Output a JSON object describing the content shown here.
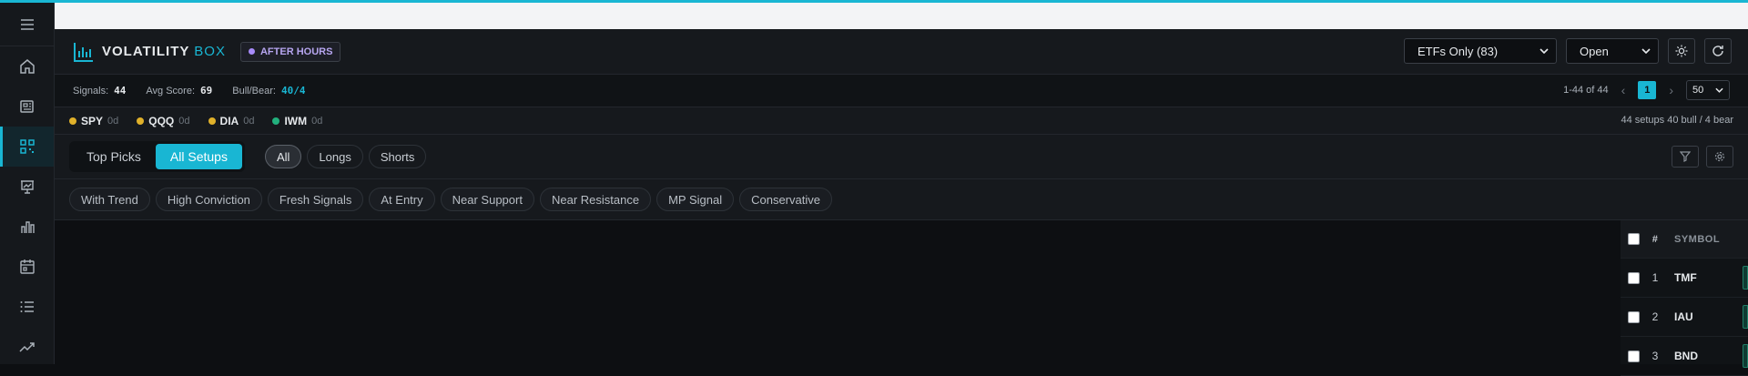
{
  "header": {
    "logo_main": "VOLATILITY",
    "logo_accent": "BOX",
    "session_badge": "AFTER HOURS",
    "universe_select": "ETFs Only (83)",
    "status_select": "Open"
  },
  "stats": {
    "signals_label": "Signals:",
    "signals_value": "44",
    "avg_score_label": "Avg Score:",
    "avg_score_value": "69",
    "bull_bear_label": "Bull/Bear:",
    "bull_bear_value": "40/4"
  },
  "pager": {
    "range": "1-44 of 44",
    "prev": "‹",
    "current_page": "1",
    "next": "›",
    "page_size": "50"
  },
  "tickers": [
    {
      "symbol": "SPY",
      "age": "0d",
      "color": "#e0b12a"
    },
    {
      "symbol": "QQQ",
      "age": "0d",
      "color": "#e0b12a"
    },
    {
      "symbol": "DIA",
      "age": "0d",
      "color": "#e0b12a"
    },
    {
      "symbol": "IWM",
      "age": "0d",
      "color": "#22b07d"
    }
  ],
  "summary": "44 setups 40 bull / 4 bear",
  "tabs": {
    "top_picks": "Top Picks",
    "all_setups": "All Setups",
    "direction": [
      "All",
      "Longs",
      "Shorts"
    ]
  },
  "filters": [
    "With Trend",
    "High Conviction",
    "Fresh Signals",
    "At Entry",
    "Near Support",
    "Near Resistance",
    "MP Signal",
    "Conservative"
  ],
  "table": {
    "col_index": "#",
    "col_symbol": "SYMBOL",
    "rows": [
      {
        "index": "1",
        "symbol": "TMF"
      },
      {
        "index": "2",
        "symbol": "IAU"
      },
      {
        "index": "3",
        "symbol": "BND"
      }
    ]
  },
  "colors": {
    "accent": "#19b6d3",
    "session": "#a78bfa"
  }
}
